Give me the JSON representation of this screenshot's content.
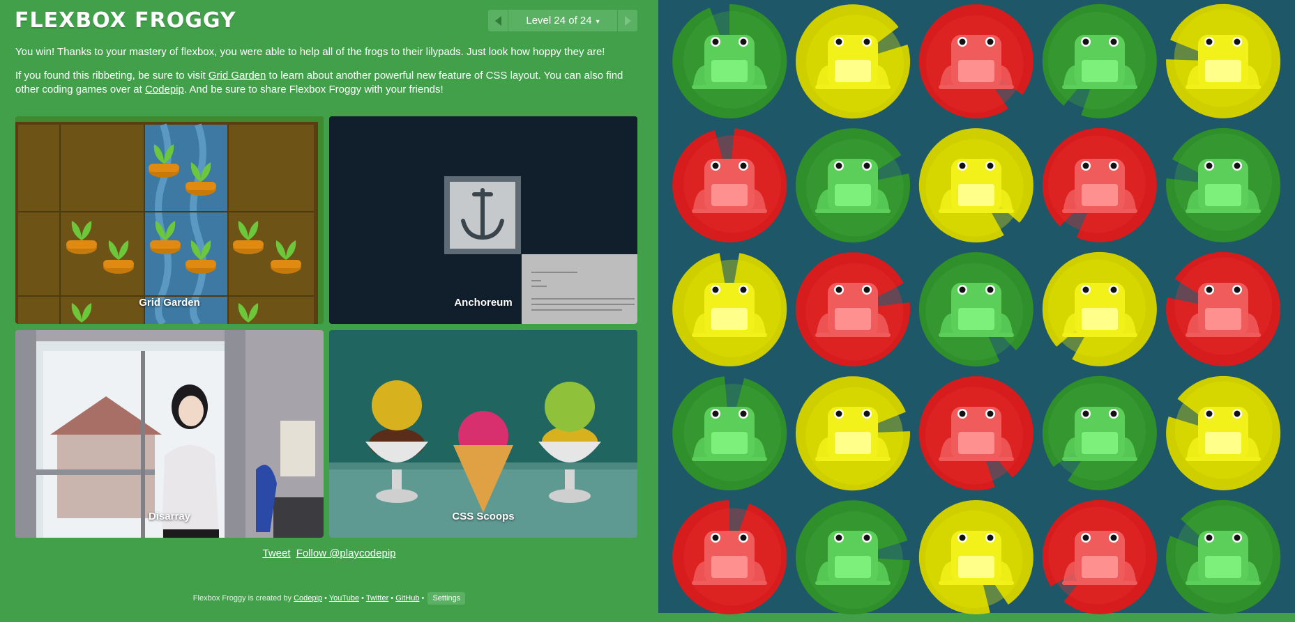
{
  "app": {
    "title": "FLEXBOX FROGGY"
  },
  "level_nav": {
    "indicator": "Level 24 of 24",
    "caret": "▾"
  },
  "message": {
    "win": "You win! Thanks to your mastery of flexbox, you were able to help all of the frogs to their lilypads. Just look how hoppy they are!",
    "promo_part1": "If you found this ribbeting, be sure to visit ",
    "grid_garden_link": "Grid Garden",
    "promo_part2": " to learn about another powerful new feature of CSS layout. You can also find other coding games over at ",
    "codepip_link": "Codepip",
    "promo_part3": ". And be sure to share Flexbox Froggy with your friends!"
  },
  "games": [
    {
      "label": "Grid Garden"
    },
    {
      "label": "Anchoreum"
    },
    {
      "label": "Disarray"
    },
    {
      "label": "CSS Scoops"
    }
  ],
  "social": {
    "tweet": "Tweet",
    "follow": "Follow @playcodepip"
  },
  "footer": {
    "prefix": "Flexbox Froggy is created by ",
    "codepip": "Codepip",
    "sep": " • ",
    "youtube": "YouTube",
    "twitter": "Twitter",
    "github": "GitHub",
    "settings": "Settings"
  },
  "colors": {
    "sidebar_bg": "#42a04b",
    "board_bg": "#1e5768",
    "green": "#2f8f2a",
    "yellow": "#cfcf00",
    "red": "#d61c1c"
  },
  "board": {
    "grid": [
      [
        "green",
        "yellow",
        "red",
        "green",
        "yellow"
      ],
      [
        "red",
        "green",
        "yellow",
        "red",
        "green"
      ],
      [
        "yellow",
        "red",
        "green",
        "yellow",
        "red"
      ],
      [
        "green",
        "yellow",
        "red",
        "green",
        "yellow"
      ],
      [
        "red",
        "green",
        "yellow",
        "red",
        "green"
      ]
    ]
  }
}
